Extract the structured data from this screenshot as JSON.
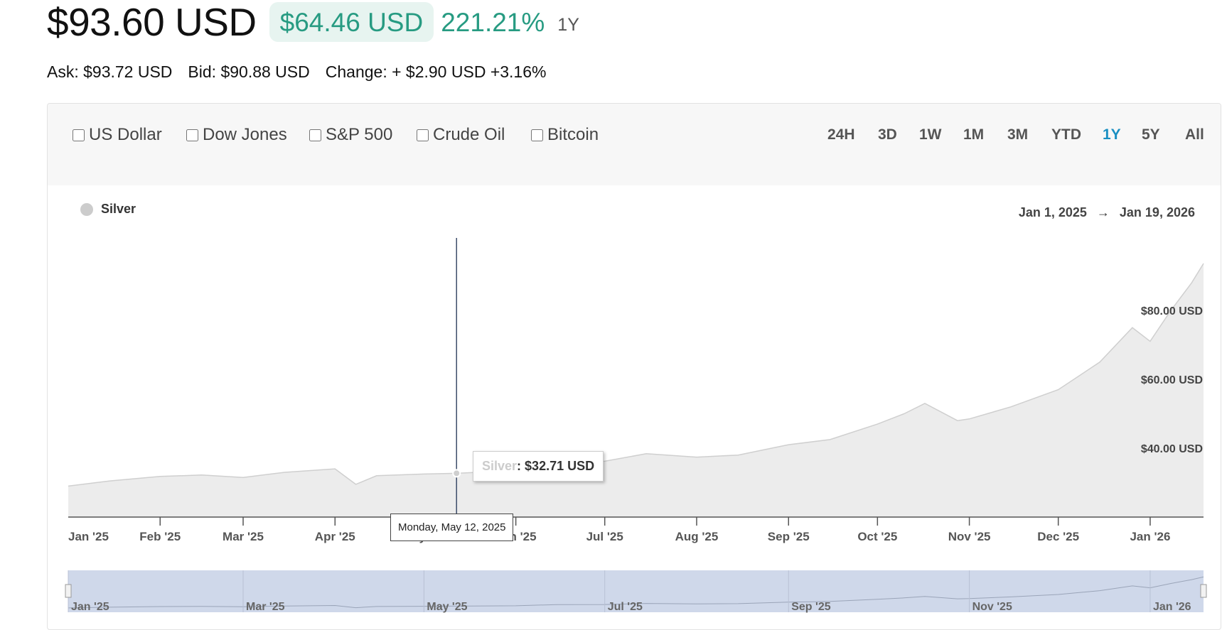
{
  "header": {
    "price": "$93.60 USD",
    "change_amount": "$64.46 USD",
    "change_percent": "221.21%",
    "period": "1Y"
  },
  "quote": {
    "ask": "Ask: $93.72 USD",
    "bid": "Bid: $90.88 USD",
    "change": "Change: + $2.90 USD +3.16%"
  },
  "compare": [
    "US Dollar",
    "Dow Jones",
    "S&P 500",
    "Crude Oil",
    "Bitcoin"
  ],
  "ranges": [
    "24H",
    "3D",
    "1W",
    "1M",
    "3M",
    "YTD",
    "1Y",
    "5Y",
    "All"
  ],
  "active_range": "1Y",
  "legend": {
    "series": "Silver",
    "color": "#cccccc"
  },
  "date_range": {
    "from": "Jan 1, 2025",
    "arrow": "→",
    "to": "Jan 19, 2026"
  },
  "tooltip": {
    "series": "Silver",
    "value": ": $32.71 USD",
    "date": "Monday, May 12, 2025"
  },
  "colors": {
    "accent_green": "#279b82",
    "active_range": "#1a8fc2",
    "navigator": "#cfd8ea"
  },
  "chart_data": {
    "type": "area",
    "series": [
      {
        "name": "Silver",
        "unit": "USD"
      }
    ],
    "x": [
      "2025-01-01",
      "2025-01-15",
      "2025-02-01",
      "2025-02-15",
      "2025-03-01",
      "2025-03-15",
      "2025-04-01",
      "2025-04-08",
      "2025-04-15",
      "2025-05-01",
      "2025-05-12",
      "2025-06-01",
      "2025-06-15",
      "2025-07-01",
      "2025-07-15",
      "2025-08-01",
      "2025-08-15",
      "2025-09-01",
      "2025-09-15",
      "2025-10-01",
      "2025-10-10",
      "2025-10-17",
      "2025-10-28",
      "2025-11-01",
      "2025-11-15",
      "2025-12-01",
      "2025-12-15",
      "2025-12-26",
      "2026-01-01",
      "2026-01-08",
      "2026-01-15",
      "2026-01-19"
    ],
    "y": [
      29.0,
      30.5,
      31.8,
      32.2,
      31.5,
      33.0,
      34.0,
      29.5,
      32.0,
      32.5,
      32.71,
      33.5,
      36.0,
      36.2,
      38.4,
      37.4,
      38.0,
      41.0,
      42.5,
      47.0,
      50.0,
      53.0,
      48.0,
      48.5,
      52.0,
      57.0,
      65.0,
      75.0,
      71.0,
      80.0,
      88.0,
      93.6
    ],
    "highlight": {
      "x": "2025-05-12",
      "y": 32.71
    },
    "x_ticks": [
      "Jan '25",
      "Feb '25",
      "Mar '25",
      "Apr '25",
      "May '25",
      "Jun '25",
      "Jul '25",
      "Aug '25",
      "Sep '25",
      "Oct '25",
      "Nov '25",
      "Dec '25",
      "Jan '26"
    ],
    "y_ticks": [
      "$40.00 USD",
      "$60.00 USD",
      "$80.00 USD"
    ],
    "navigator_ticks": [
      "Jan '25",
      "Mar '25",
      "May '25",
      "Jul '25",
      "Sep '25",
      "Nov '25",
      "Jan '26"
    ]
  }
}
